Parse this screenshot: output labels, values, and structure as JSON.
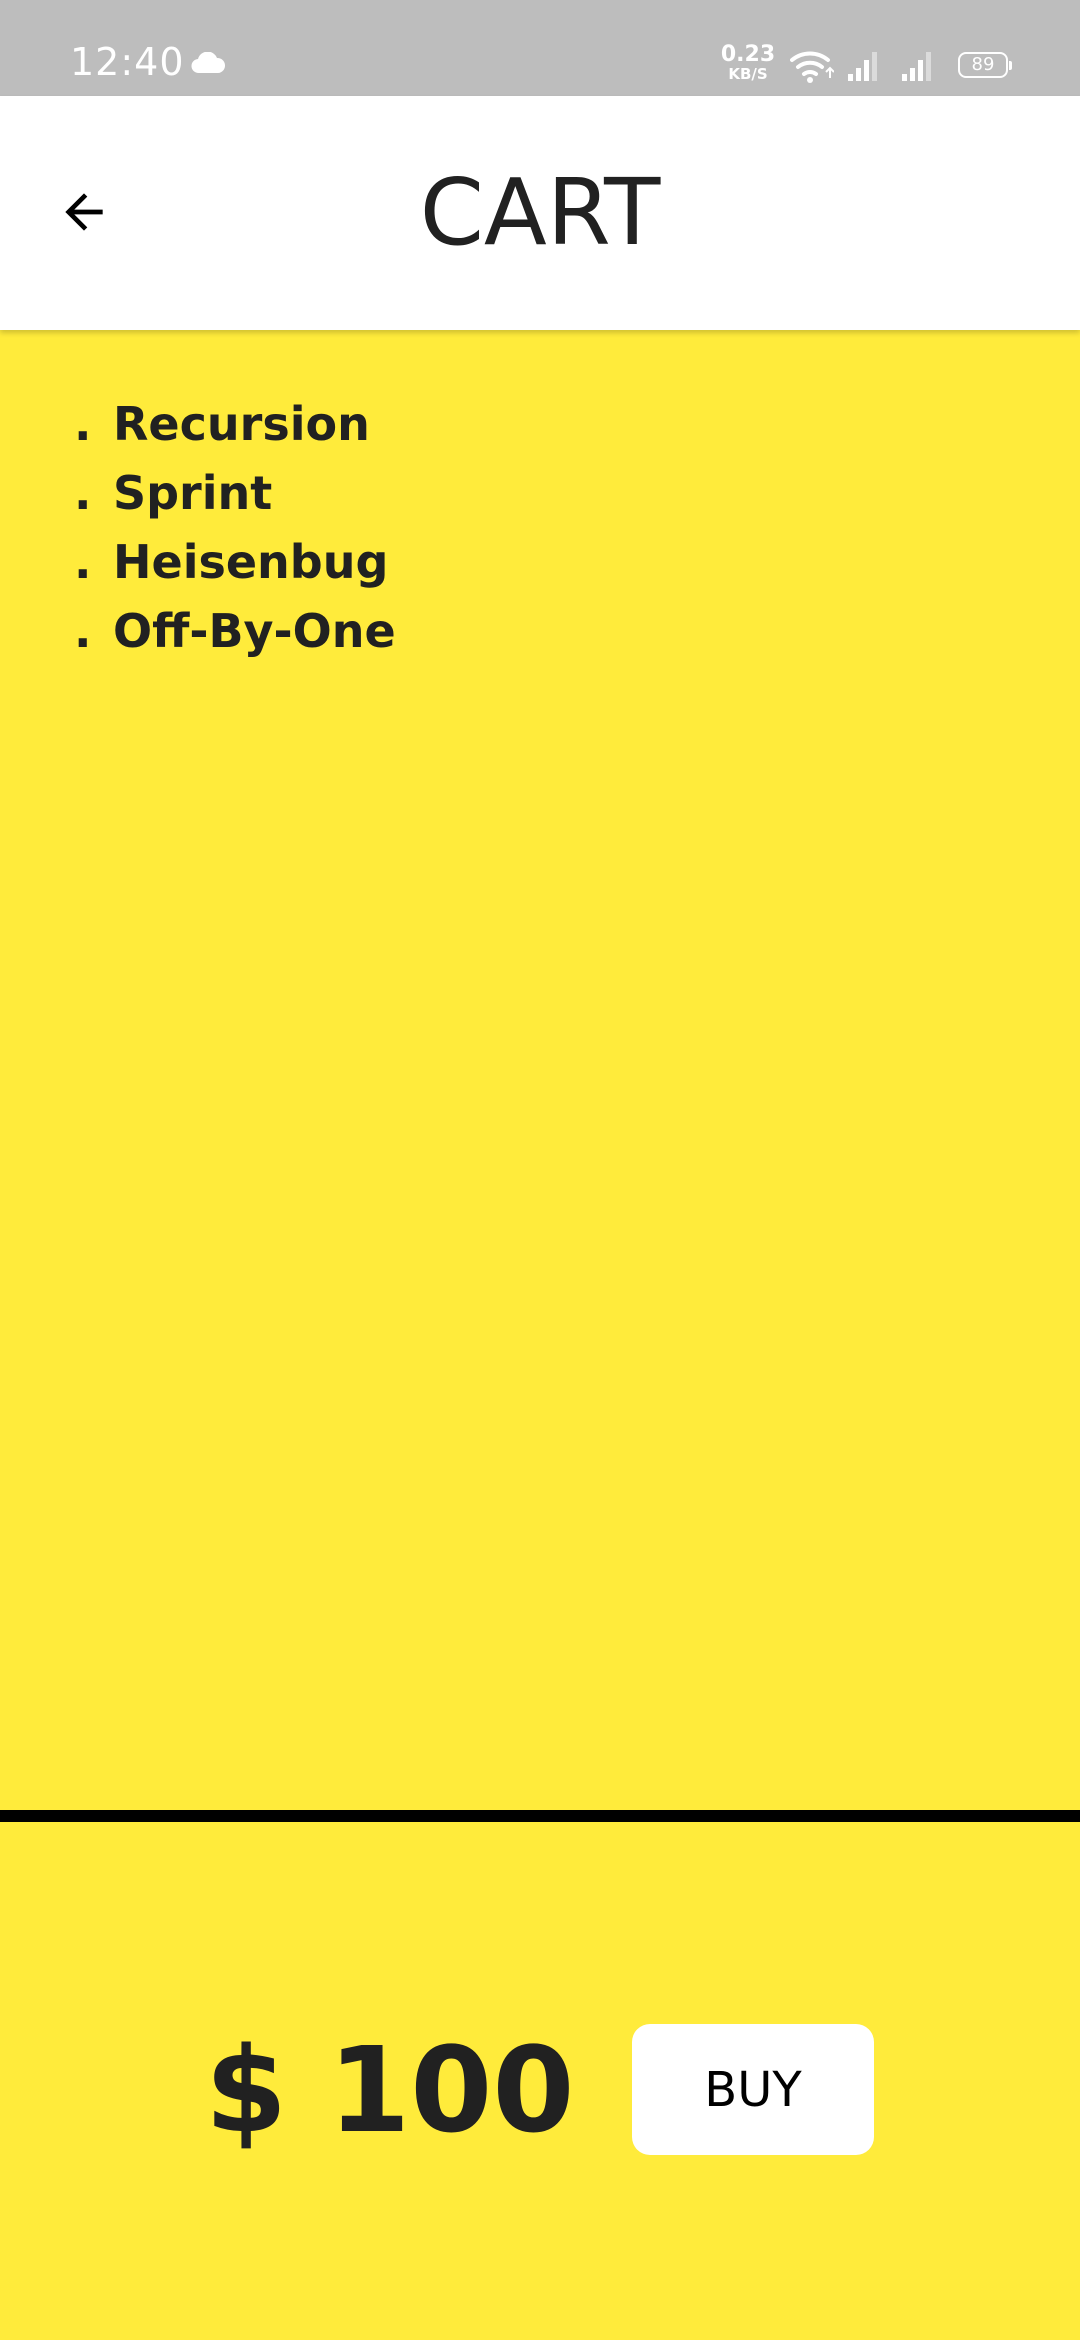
{
  "status_bar": {
    "time": "12:40",
    "net_speed_value": "0.23",
    "net_speed_unit": "KB/S",
    "battery_level": "89"
  },
  "app_bar": {
    "title": "CART",
    "back_icon": "arrow-back-icon"
  },
  "cart": {
    "bullet": ".",
    "items": [
      {
        "label": "Recursion"
      },
      {
        "label": "Sprint"
      },
      {
        "label": "Heisenbug"
      },
      {
        "label": "Off-By-One"
      }
    ]
  },
  "footer": {
    "total": "$ 100",
    "buy_label": "BUY"
  },
  "colors": {
    "background": "#FFEB3B",
    "status_bar": "#BDBDBD",
    "app_bar": "#FFFFFF",
    "text": "#212121",
    "divider": "#000000"
  }
}
